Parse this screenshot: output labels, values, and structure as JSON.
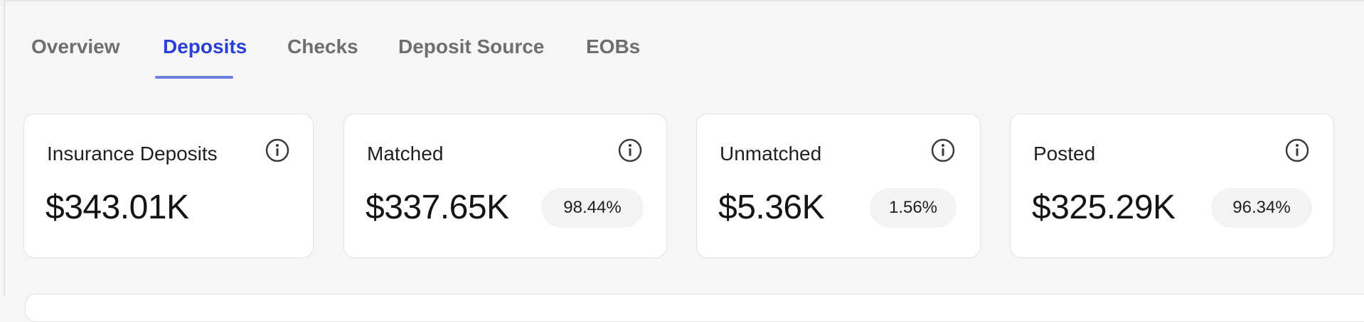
{
  "tabs": [
    {
      "label": "Overview",
      "active": false
    },
    {
      "label": "Deposits",
      "active": true
    },
    {
      "label": "Checks",
      "active": false
    },
    {
      "label": "Deposit Source",
      "active": false
    },
    {
      "label": "EOBs",
      "active": false
    }
  ],
  "cards": [
    {
      "label": "Insurance Deposits",
      "value": "$343.01K",
      "percent": null,
      "icon": "info-icon"
    },
    {
      "label": "Matched",
      "value": "$337.65K",
      "percent": "98.44%",
      "icon": "info-icon"
    },
    {
      "label": "Unmatched",
      "value": "$5.36K",
      "percent": "1.56%",
      "icon": "info-icon"
    },
    {
      "label": "Posted",
      "value": "$325.29K",
      "percent": "96.34%",
      "icon": "info-icon"
    }
  ],
  "colors": {
    "active_tab": "#2a3fd6",
    "tab_underline": "#6e7fe6",
    "inactive_tab": "#6e6e6e",
    "background": "#f6f6f6",
    "card": "#ffffff"
  }
}
